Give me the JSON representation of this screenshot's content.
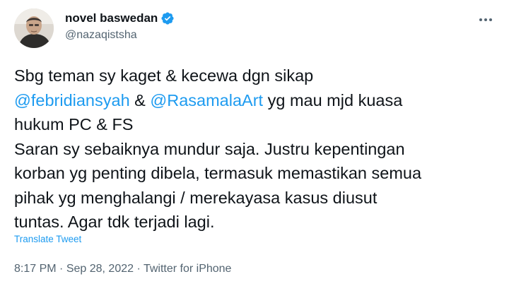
{
  "author": {
    "display_name": "novel baswedan",
    "handle": "@nazaqistsha",
    "verified": true
  },
  "more_icon": "more-dots-icon",
  "tweet": {
    "line1": "Sbg teman sy kaget & kecewa dgn sikap",
    "mention1": "@febridiansyah",
    "amp": " & ",
    "mention2": "@RasamalaArt",
    "line2_rest": " yg mau mjd kuasa",
    "line3": "hukum PC & FS",
    "line4": "Saran sy sebaiknya mundur saja. Justru kepentingan",
    "line5": "korban yg penting dibela, termasuk memastikan semua",
    "line6": "pihak yg menghalangi / merekayasa kasus diusut",
    "line7": "tuntas. Agar tdk terjadi lagi."
  },
  "translate_label": "Translate Tweet",
  "meta": {
    "time": "8:17 PM",
    "sep1": " · ",
    "date": "Sep 28, 2022",
    "sep2": " · ",
    "source": "Twitter for iPhone"
  },
  "colors": {
    "link": "#1d9bf0",
    "text": "#0f1419",
    "secondary": "#536471"
  }
}
